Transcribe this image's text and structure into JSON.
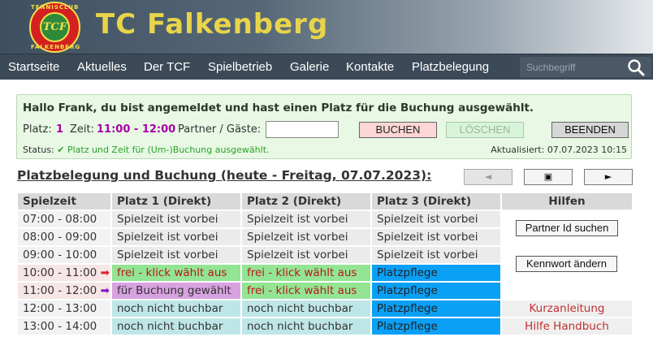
{
  "header": {
    "title": "TC Falkenberg",
    "logo": {
      "top_text": "TENNISCLUB",
      "center_text": "TCF",
      "bottom_text": "FALKENBERG"
    }
  },
  "nav": {
    "items": [
      "Startseite",
      "Aktuelles",
      "Der TCF",
      "Spielbetrieb",
      "Galerie",
      "Kontakte",
      "Platzbelegung"
    ],
    "search_placeholder": "Suchbegriff",
    "search_icon": "search-icon"
  },
  "booking": {
    "greeting": "Hallo Frank, du bist angemeldet und hast einen Platz für die Buchung ausgewählt.",
    "platz_label": "Platz:",
    "platz_value": "1",
    "zeit_label": "Zeit:",
    "zeit_value": "11:00 - 12:00",
    "partner_label": "Partner / Gäste:",
    "partner_value": "",
    "buttons": {
      "buchen": "BUCHEN",
      "loeschen": "LÖSCHEN",
      "beenden": "BEENDEN"
    },
    "status_label": "Status:",
    "status_check": "✔",
    "status_text": "Platz und Zeit für (Um-)Buchung ausgewählt.",
    "updated": "Aktualisiert: 07.07.2023 10:15"
  },
  "schedule": {
    "title": "Platzbelegung und Buchung (heute - Freitag, 07.07.2023):",
    "nav_prev": "◄",
    "nav_today": "▣",
    "nav_next": "►",
    "headers": [
      "Spielzeit",
      "Platz 1 (Direkt)",
      "Platz 2 (Direkt)",
      "Platz 3 (Direkt)",
      "Hilfen"
    ],
    "rows": [
      {
        "time": "07:00 - 08:00",
        "arrow": "",
        "p1": "Spielzeit ist vorbei",
        "p2": "Spielzeit ist vorbei",
        "p3": "Spielzeit ist vorbei"
      },
      {
        "time": "08:00 - 09:00",
        "arrow": "",
        "p1": "Spielzeit ist vorbei",
        "p2": "Spielzeit ist vorbei",
        "p3": "Spielzeit ist vorbei"
      },
      {
        "time": "09:00 - 10:00",
        "arrow": "",
        "p1": "Spielzeit ist vorbei",
        "p2": "Spielzeit ist vorbei",
        "p3": "Spielzeit ist vorbei"
      },
      {
        "time": "10:00 - 11:00",
        "arrow": "➡",
        "p1": "frei - klick wählt aus",
        "p2": "frei - klick wählt aus",
        "p3": "Platzpflege"
      },
      {
        "time": "11:00 - 12:00",
        "arrow": "➡",
        "p1": "für Buchung gewählt",
        "p2": "frei - klick wählt aus",
        "p3": "Platzpflege"
      },
      {
        "time": "12:00 - 13:00",
        "arrow": "",
        "p1": "noch nicht buchbar",
        "p2": "noch nicht buchbar",
        "p3": "Platzpflege"
      },
      {
        "time": "13:00 - 14:00",
        "arrow": "",
        "p1": "noch nicht buchbar",
        "p2": "noch nicht buchbar",
        "p3": "Platzpflege"
      }
    ],
    "help": {
      "partner_id": "Partner Id suchen",
      "password": "Kennwort ändern",
      "kurzanleitung": "Kurzanleitung",
      "handbuch": "Hilfe Handbuch"
    }
  },
  "colors": {
    "header_title": "#e9d44a",
    "nav_bg": "#3c4a58",
    "free": "#93e493",
    "selected": "#d8a2e0",
    "maintenance": "#0aa0f6",
    "not_bookable": "#bfe6e6",
    "past": "#ebebeb"
  }
}
